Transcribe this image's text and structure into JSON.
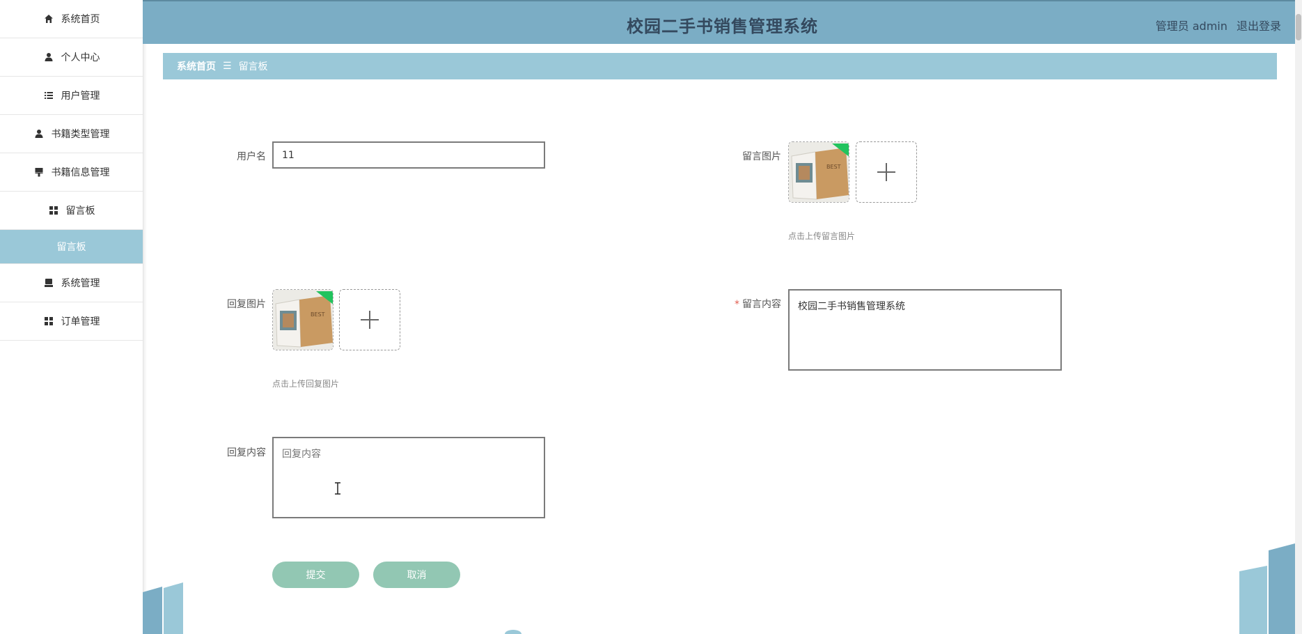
{
  "app_title": "校园二手书销售管理系统",
  "header_user": {
    "role_name": "管理员 admin",
    "logout_label": "退出登录"
  },
  "sidebar": {
    "items": [
      {
        "label": "系统首页",
        "icon": "home-icon"
      },
      {
        "label": "个人中心",
        "icon": "person-icon"
      },
      {
        "label": "用户管理",
        "icon": "list-icon"
      },
      {
        "label": "书籍类型管理",
        "icon": "person-icon"
      },
      {
        "label": "书籍信息管理",
        "icon": "brush-icon"
      },
      {
        "label": "留言板",
        "icon": "grid-icon"
      },
      {
        "label": "留言板",
        "icon": "",
        "active": true
      },
      {
        "label": "系统管理",
        "icon": "printer-icon"
      },
      {
        "label": "订单管理",
        "icon": "grid-icon"
      }
    ]
  },
  "breadcrumb": {
    "home": "系统首页",
    "separator": "☰",
    "current": "留言板"
  },
  "form": {
    "username": {
      "label": "用户名",
      "value": "11"
    },
    "message_image": {
      "label": "留言图片",
      "hint": "点击上传留言图片"
    },
    "reply_image": {
      "label": "回复图片",
      "hint": "点击上传回复图片"
    },
    "message_content": {
      "label": "留言内容",
      "required_mark": "*",
      "value": "校园二手书销售管理系统"
    },
    "reply_content": {
      "label": "回复内容",
      "placeholder": "回复内容",
      "value": ""
    }
  },
  "buttons": {
    "submit": "提交",
    "cancel": "取消"
  },
  "colors": {
    "header": "#7badc5",
    "breadcrumb": "#9ac8d8",
    "button": "#92c7b3",
    "sidebar_active": "#9ac8d8"
  }
}
